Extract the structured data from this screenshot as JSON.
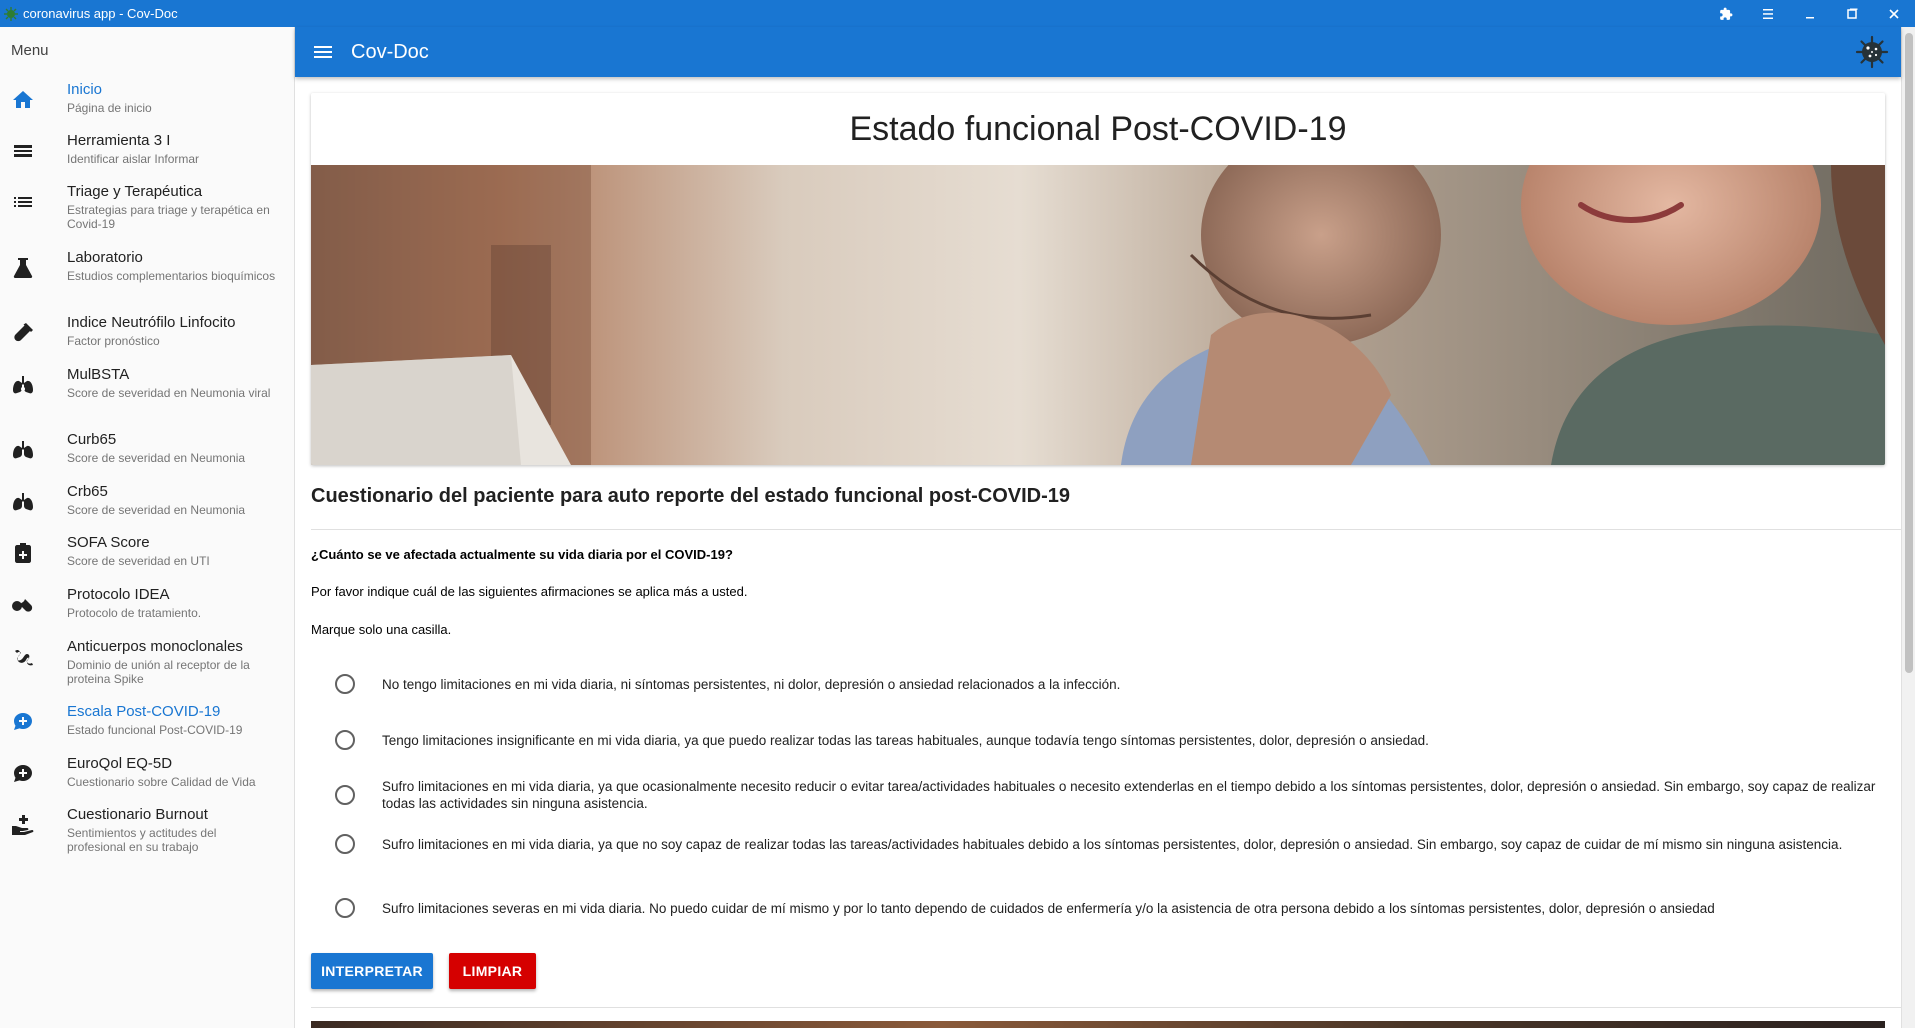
{
  "window": {
    "title": "coronavirus app - Cov-Doc"
  },
  "sidebar": {
    "menu_title": "Menu",
    "items": [
      {
        "label": "Inicio",
        "sub": "Página de inicio",
        "icon": "home-icon",
        "active": true
      },
      {
        "label": "Herramienta 3 I",
        "sub": "Identificar aislar Informar",
        "icon": "list-bars-icon",
        "active": false
      },
      {
        "label": "Triage y Terapéutica",
        "sub": "Estrategias para triage y terapética en Covid-19",
        "icon": "bullet-list-icon",
        "active": false
      },
      {
        "label": "Laboratorio",
        "sub": "Estudios complementarios bioquímicos",
        "icon": "flask-icon",
        "active": false
      },
      {
        "label": "Indice Neutrófilo Linfocito",
        "sub": "Factor pronóstico",
        "icon": "test-tube-icon",
        "active": false
      },
      {
        "label": "MulBSTA",
        "sub": "Score de severidad en Neumonia viral",
        "icon": "lungs-virus-icon",
        "active": false
      },
      {
        "label": "Curb65",
        "sub": "Score de severidad en Neumonia",
        "icon": "lungs-icon",
        "active": false
      },
      {
        "label": "Crb65",
        "sub": "Score de severidad en Neumonia",
        "icon": "lungs-icon",
        "active": false
      },
      {
        "label": "SOFA Score",
        "sub": "Score de severidad en UTI",
        "icon": "medical-clipboard-icon",
        "active": false
      },
      {
        "label": "Protocolo IDEA",
        "sub": "Protocolo de tratamiento.",
        "icon": "pills-icon",
        "active": false
      },
      {
        "label": "Anticuerpos monoclonales",
        "sub": "Dominio de unión al receptor de la proteina Spike",
        "icon": "molecule-icon",
        "active": false
      },
      {
        "label": "Escala Post-COVID-19",
        "sub": "Estado funcional Post-COVID-19",
        "icon": "chat-plus-icon",
        "active": true
      },
      {
        "label": "EuroQol EQ-5D",
        "sub": "Cuestionario sobre Calidad de Vida",
        "icon": "chat-plus-icon",
        "active": false
      },
      {
        "label": "Cuestionario Burnout",
        "sub": "Sentimientos y actitudes del profesional en su trabajo",
        "icon": "hand-plus-icon",
        "active": false
      }
    ]
  },
  "appbar": {
    "title": "Cov-Doc"
  },
  "card": {
    "title": "Estado funcional Post-COVID-19"
  },
  "form": {
    "section_title": "Cuestionario del paciente para auto reporte del estado funcional post-COVID-19",
    "question": "¿Cuánto se ve afectada actualmente su vida diaria por el COVID-19?",
    "instruction1": "Por favor indique cuál de las siguientes afirmaciones se aplica más a usted.",
    "instruction2": "Marque solo una casilla.",
    "options": [
      "No tengo limitaciones en mi vida diaria, ni síntomas persistentes, ni dolor, depresión o ansiedad relacionados a la infección.",
      "Tengo limitaciones insignificante en mi vida diaria, ya que puedo realizar todas las tareas habituales, aunque todavía tengo síntomas persistentes, dolor, depresión o ansiedad.",
      "Sufro limitaciones en mi vida diaria, ya que ocasionalmente necesito reducir o evitar tarea/actividades habituales o necesito extenderlas en el tiempo debido a los síntomas persistentes, dolor, depresión o ansiedad. Sin embargo, soy capaz de realizar todas las actividades sin ninguna asistencia.",
      "Sufro limitaciones en mi vida diaria, ya que no soy capaz de realizar todas las tareas/actividades habituales debido a los síntomas persistentes, dolor, depresión o ansiedad. Sin embargo, soy capaz de cuidar de mí mismo sin ninguna asistencia.",
      "Sufro limitaciones severas en mi vida diaria. No puedo cuidar de mí mismo y por lo tanto dependo de cuidados de enfermería y/o la asistencia de otra persona debido a los síntomas persistentes, dolor, depresión o ansiedad"
    ],
    "interpret_label": "INTERPRETAR",
    "clear_label": "LIMPIAR"
  },
  "colors": {
    "primary": "#1976d2",
    "danger": "#d50000"
  }
}
